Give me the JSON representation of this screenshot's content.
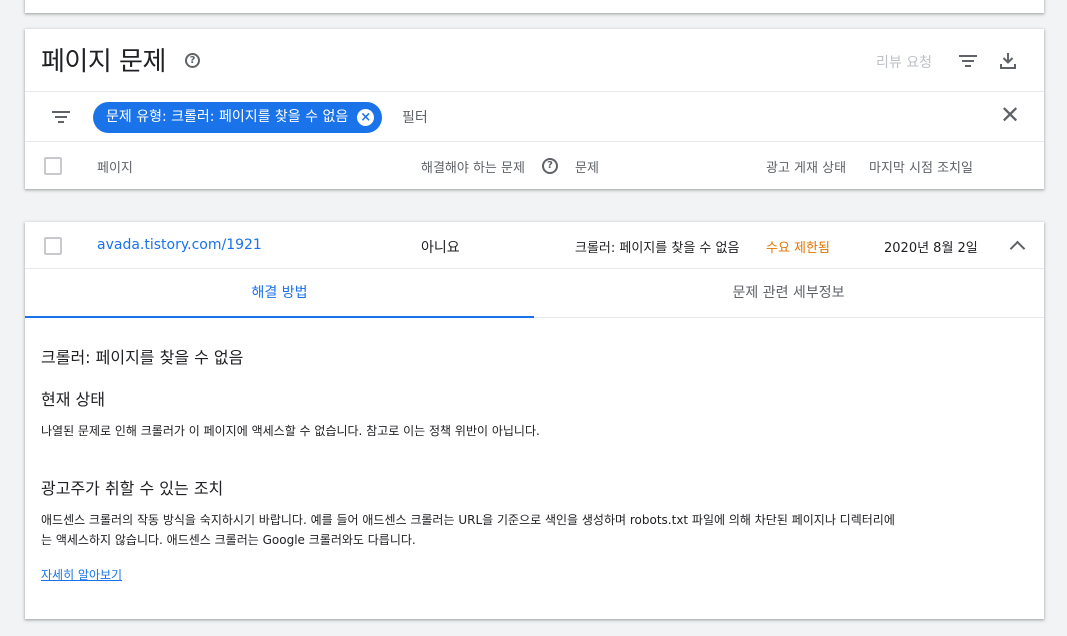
{
  "header": {
    "title": "페이지 문제",
    "review_label": "리뷰 요청"
  },
  "filter_bar": {
    "chip_label": "문제 유형: 크롤러: 페이지를 찾을 수 없음",
    "filter_placeholder": "필터"
  },
  "columns": {
    "page": "페이지",
    "must_fix": "해결해야 하는 문제",
    "issue": "문제",
    "ad_status": "광고 게재 상태",
    "last_action": "마지막 시점 조치일"
  },
  "row": {
    "page_url": "avada.tistory.com/1921",
    "must_fix": "아니요",
    "issue": "크롤러: 페이지를 찾을 수 없음",
    "ad_status": "수요 제한됨",
    "date": "2020년 8월 2일"
  },
  "tabs": [
    {
      "label": "해결 방법",
      "active": true
    },
    {
      "label": "문제 관련 세부정보",
      "active": false
    }
  ],
  "detail": {
    "issue_title": "크롤러: 페이지를 찾을 수 없음",
    "status_heading": "현재 상태",
    "status_text": "나열된 문제로 인해 크롤러가 이 페이지에 액세스할 수 없습니다. 참고로 이는 정책 위반이 아닙니다.",
    "action_heading": "광고주가 취할 수 있는 조치",
    "action_text_1": "애드센스 크롤러의 작동 방식을 숙지하시기 바랍니다. 예를 들어 애드센스 크롤러는 URL을 기준으로 색인을 생성하며 robots.txt 파일에 의해 차단된 페이지나 디렉터리에",
    "action_text_2": "는 액세스하지 않습니다. 애드센스 크롤러는 Google 크롤러와도 다릅니다.",
    "learn_more": "자세히 알아보기"
  },
  "colors": {
    "accent": "#1a73e8",
    "warning": "#e37400"
  }
}
